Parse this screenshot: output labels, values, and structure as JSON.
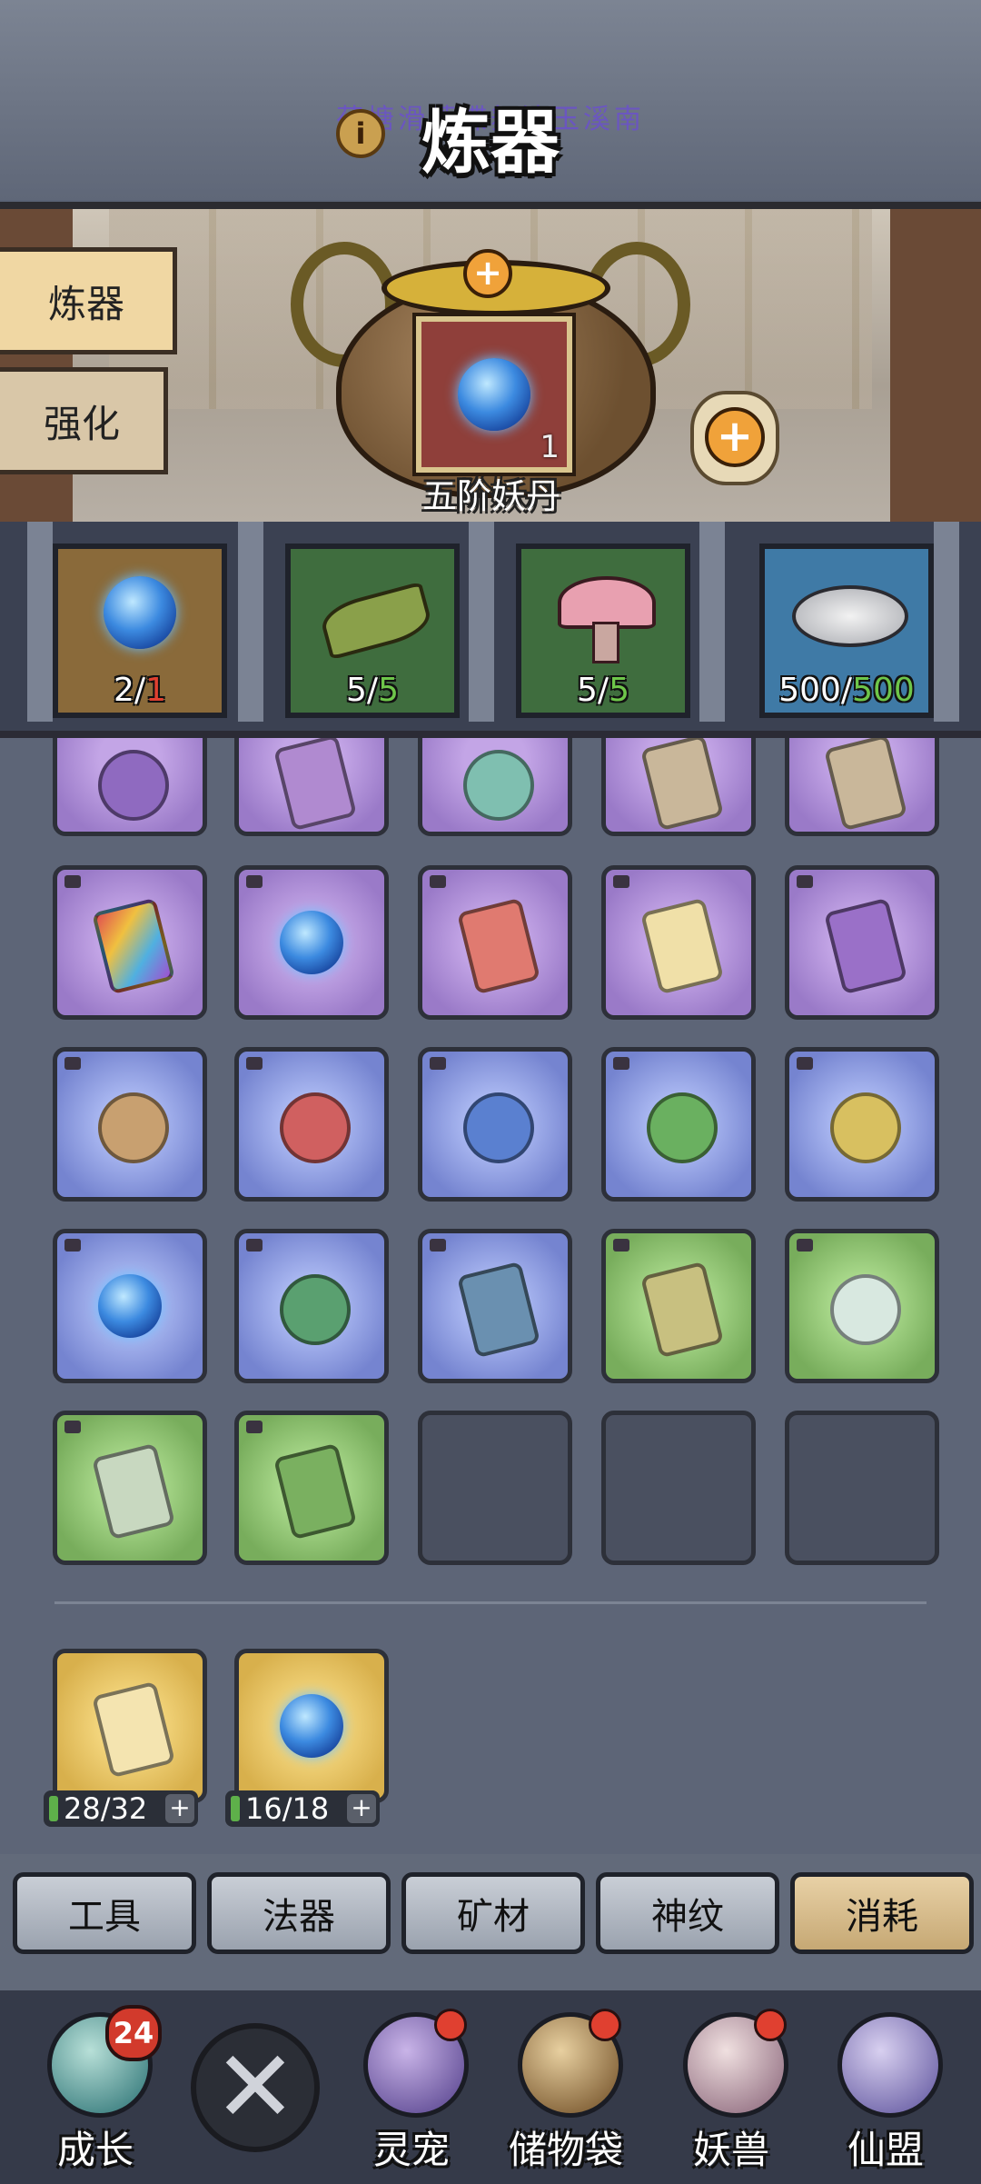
{
  "header": {
    "title": "炼器",
    "info_icon": "i",
    "watermark": "荷塘滑落蝶舞漆玉溪南"
  },
  "side_tabs": [
    {
      "label": "炼器",
      "active": true
    },
    {
      "label": "强化",
      "active": false
    }
  ],
  "cauldron": {
    "add_symbol": "+",
    "item_name": "五阶妖丹",
    "item_count": "1",
    "bag_add_symbol": "+"
  },
  "materials": [
    {
      "icon": "blue-orb-icon",
      "have": "2",
      "sep": "/",
      "need": "1",
      "status": "insufficient"
    },
    {
      "icon": "herb-icon",
      "have": "5",
      "sep": "/",
      "need": "5",
      "status": "ok"
    },
    {
      "icon": "mushroom-icon",
      "have": "5",
      "sep": "/",
      "need": "5",
      "status": "ok"
    },
    {
      "icon": "silver-ingot-icon",
      "have": "500",
      "sep": "/",
      "need": "500",
      "status": "ok"
    }
  ],
  "inventory": {
    "rows": [
      [
        "purple",
        "purple",
        "purple",
        "purple",
        "purple"
      ],
      [
        "purple",
        "purple",
        "purple",
        "purple",
        "purple"
      ],
      [
        "blue",
        "blue",
        "blue",
        "blue",
        "blue"
      ],
      [
        "blue",
        "blue",
        "blue",
        "green",
        "green"
      ],
      [
        "green",
        "green",
        "empty",
        "empty",
        "empty"
      ]
    ],
    "consumables": [
      {
        "rarity": "gold",
        "icon": "gold-scroll-icon",
        "count": "28/32",
        "add": "+"
      },
      {
        "rarity": "gold",
        "icon": "blue-orb-icon",
        "count": "16/18",
        "add": "+"
      }
    ]
  },
  "categories": [
    {
      "label": "工具",
      "active": false
    },
    {
      "label": "法器",
      "active": false
    },
    {
      "label": "矿材",
      "active": false
    },
    {
      "label": "神纹",
      "active": false
    },
    {
      "label": "消耗",
      "active": true
    }
  ],
  "bottom_nav": [
    {
      "label": "成长",
      "badge": "24",
      "dot": false
    },
    {
      "label": "灵宠",
      "badge": "",
      "dot": true
    },
    {
      "label": "储物袋",
      "badge": "",
      "dot": true
    },
    {
      "label": "妖兽",
      "badge": "",
      "dot": true
    },
    {
      "label": "仙盟",
      "badge": "",
      "dot": false
    }
  ],
  "close_symbol": "✕",
  "colors": {
    "background": "#5a6375",
    "insufficient": "#e04030",
    "sufficient": "#6ec64a",
    "active_tab": "#e8d1a6"
  }
}
